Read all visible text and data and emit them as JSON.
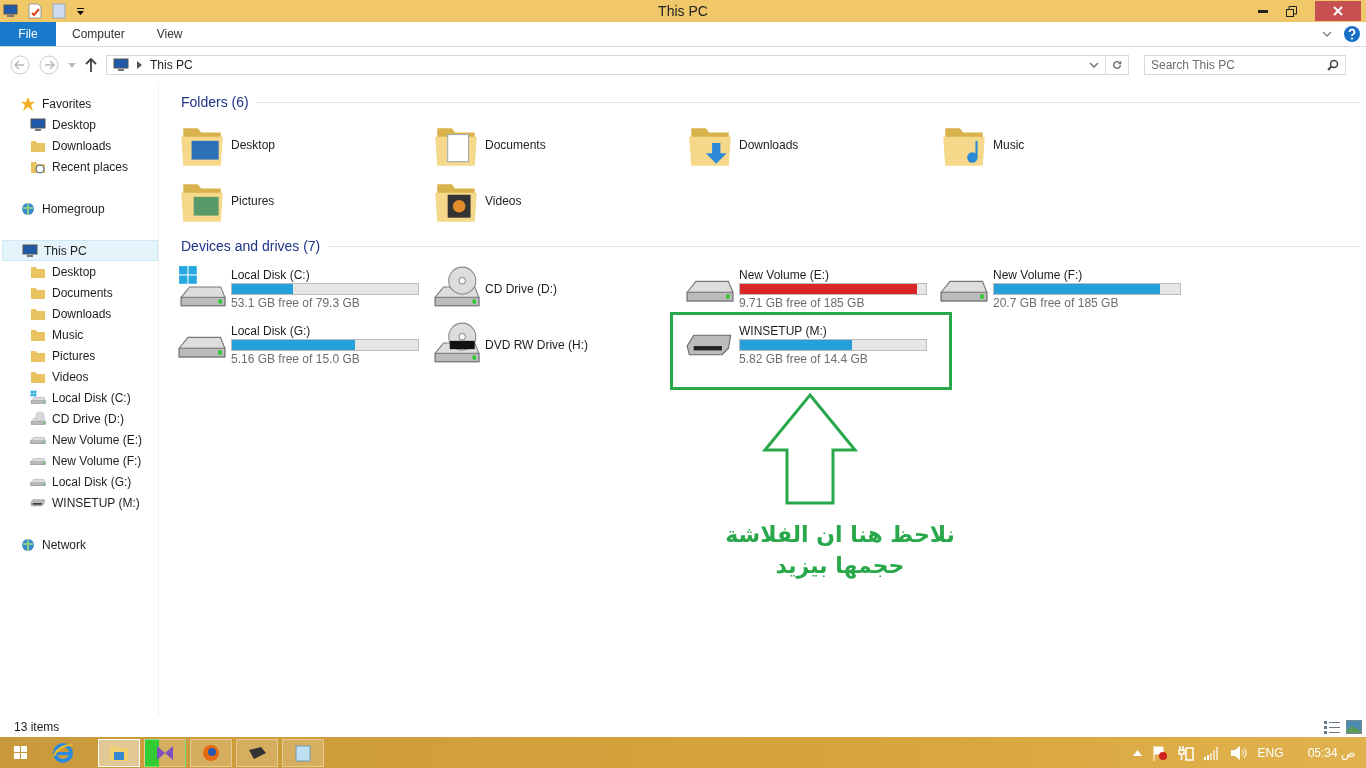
{
  "window": {
    "title": "This PC"
  },
  "ribbon_tabs": [
    {
      "label": "File",
      "kind": "file"
    },
    {
      "label": "Computer",
      "kind": "tab"
    },
    {
      "label": "View",
      "kind": "tab"
    }
  ],
  "address": {
    "path": "This PC"
  },
  "search": {
    "placeholder": "Search This PC"
  },
  "sidebar": [
    {
      "label": "Favorites",
      "kind": "star",
      "selected": false,
      "children": [
        {
          "label": "Desktop",
          "kind": "desktop",
          "selected": false
        },
        {
          "label": "Downloads",
          "kind": "folder",
          "selected": false
        },
        {
          "label": "Recent places",
          "kind": "recent",
          "selected": false
        }
      ]
    },
    {
      "label": "Homegroup",
      "kind": "homegroup",
      "selected": false
    },
    {
      "label": "This PC",
      "kind": "pc",
      "selected": true,
      "children": [
        {
          "label": "Desktop",
          "kind": "folder",
          "selected": false
        },
        {
          "label": "Documents",
          "kind": "folder",
          "selected": false
        },
        {
          "label": "Downloads",
          "kind": "folder",
          "selected": false
        },
        {
          "label": "Music",
          "kind": "folder",
          "selected": false
        },
        {
          "label": "Pictures",
          "kind": "folder",
          "selected": false
        },
        {
          "label": "Videos",
          "kind": "folder",
          "selected": false
        },
        {
          "label": "Local Disk (C:)",
          "kind": "system",
          "selected": false
        },
        {
          "label": "CD Drive (D:)",
          "kind": "cd",
          "selected": false
        },
        {
          "label": "New Volume (E:)",
          "kind": "disk",
          "selected": false
        },
        {
          "label": "New Volume (F:)",
          "kind": "disk",
          "selected": false
        },
        {
          "label": "Local Disk (G:)",
          "kind": "disk",
          "selected": false
        },
        {
          "label": "WINSETUP (M:)",
          "kind": "usb",
          "selected": false
        }
      ]
    },
    {
      "label": "Network",
      "kind": "network",
      "selected": false
    }
  ],
  "folders": {
    "title": "Folders (6)",
    "items": [
      {
        "label": "Desktop",
        "kind": "desktop"
      },
      {
        "label": "Documents",
        "kind": "documents"
      },
      {
        "label": "Downloads",
        "kind": "downloads"
      },
      {
        "label": "Music",
        "kind": "music"
      },
      {
        "label": "Pictures",
        "kind": "pictures"
      },
      {
        "label": "Videos",
        "kind": "videos"
      }
    ]
  },
  "drives": {
    "title": "Devices and drives (7)",
    "items": [
      {
        "label": "Local Disk (C:)",
        "kind": "system",
        "level": 0.33,
        "free": "53.1 GB free of 79.3 GB",
        "critical": false
      },
      {
        "label": "CD Drive (D:)",
        "kind": "cd"
      },
      {
        "label": "New Volume (E:)",
        "kind": "disk",
        "level": 0.95,
        "free": "9.71 GB free of 185 GB",
        "critical": true
      },
      {
        "label": "New Volume (F:)",
        "kind": "disk",
        "level": 0.89,
        "free": "20.7 GB free of 185 GB",
        "critical": false
      },
      {
        "label": "Local Disk (G:)",
        "kind": "disk",
        "level": 0.66,
        "free": "5.16 GB free of 15.0 GB",
        "critical": false
      },
      {
        "label": "DVD RW Drive (H:)",
        "kind": "dvd"
      },
      {
        "label": "WINSETUP (M:)",
        "kind": "usb",
        "level": 0.6,
        "free": "5.82 GB free of 14.4 GB",
        "critical": false
      }
    ]
  },
  "annotation": {
    "lines": [
      "نلاحظ هنا ان الفلاشة",
      "حجمها بيزيد"
    ]
  },
  "status_bar": {
    "count": "13 items"
  },
  "taskbar": {
    "language": "ENG",
    "clock": "05:34 ص"
  }
}
